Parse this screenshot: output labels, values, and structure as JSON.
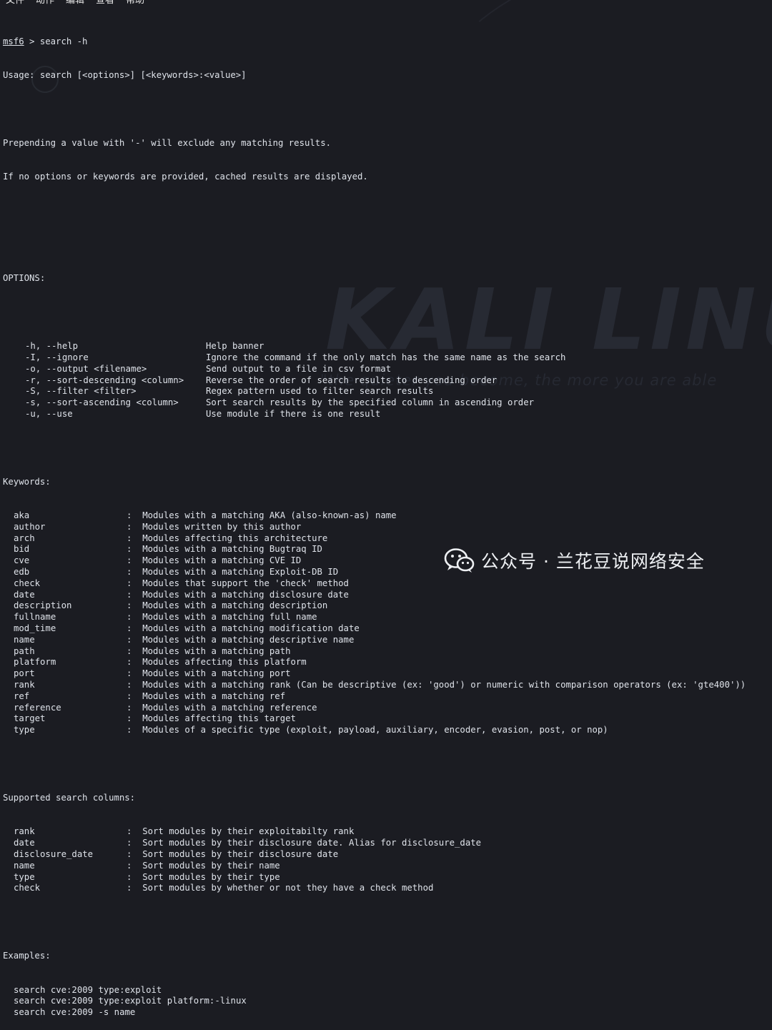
{
  "menu": [
    "文件",
    "动作",
    "编辑",
    "查看",
    "帮助"
  ],
  "wallpaper": {
    "logo": "KALI LINU",
    "tagline": "\"the quieter you become, the more you are able"
  },
  "terminal": {
    "prompt_host": "msf6",
    "prompt_rest": " > search -h",
    "usage": "Usage: search [<options>] [<keywords>:<value>]",
    "intro_1": "Prepending a value with '-' will exclude any matching results.",
    "intro_2": "If no options or keywords are provided, cached results are displayed.",
    "options_header": "OPTIONS:",
    "options": [
      {
        "flag": "-h, --help",
        "desc": "Help banner"
      },
      {
        "flag": "-I, --ignore",
        "desc": "Ignore the command if the only match has the same name as the search"
      },
      {
        "flag": "-o, --output <filename>",
        "desc": "Send output to a file in csv format"
      },
      {
        "flag": "-r, --sort-descending <column>",
        "desc": "Reverse the order of search results to descending order"
      },
      {
        "flag": "-S, --filter <filter>",
        "desc": "Regex pattern used to filter search results"
      },
      {
        "flag": "-s, --sort-ascending <column>",
        "desc": "Sort search results by the specified column in ascending order"
      },
      {
        "flag": "-u, --use",
        "desc": "Use module if there is one result"
      }
    ],
    "keywords_header": "Keywords:",
    "keywords": [
      {
        "key": "aka",
        "desc": ":  Modules with a matching AKA (also-known-as) name"
      },
      {
        "key": "author",
        "desc": ":  Modules written by this author"
      },
      {
        "key": "arch",
        "desc": ":  Modules affecting this architecture"
      },
      {
        "key": "bid",
        "desc": ":  Modules with a matching Bugtraq ID"
      },
      {
        "key": "cve",
        "desc": ":  Modules with a matching CVE ID"
      },
      {
        "key": "edb",
        "desc": ":  Modules with a matching Exploit-DB ID"
      },
      {
        "key": "check",
        "desc": ":  Modules that support the 'check' method"
      },
      {
        "key": "date",
        "desc": ":  Modules with a matching disclosure date"
      },
      {
        "key": "description",
        "desc": ":  Modules with a matching description"
      },
      {
        "key": "fullname",
        "desc": ":  Modules with a matching full name"
      },
      {
        "key": "mod_time",
        "desc": ":  Modules with a matching modification date"
      },
      {
        "key": "name",
        "desc": ":  Modules with a matching descriptive name"
      },
      {
        "key": "path",
        "desc": ":  Modules with a matching path"
      },
      {
        "key": "platform",
        "desc": ":  Modules affecting this platform"
      },
      {
        "key": "port",
        "desc": ":  Modules with a matching port"
      },
      {
        "key": "rank",
        "desc": ":  Modules with a matching rank (Can be descriptive (ex: 'good') or numeric with comparison operators (ex: 'gte400'))"
      },
      {
        "key": "ref",
        "desc": ":  Modules with a matching ref"
      },
      {
        "key": "reference",
        "desc": ":  Modules with a matching reference"
      },
      {
        "key": "target",
        "desc": ":  Modules affecting this target"
      },
      {
        "key": "type",
        "desc": ":  Modules of a specific type (exploit, payload, auxiliary, encoder, evasion, post, or nop)"
      }
    ],
    "columns_header": "Supported search columns:",
    "columns": [
      {
        "key": "rank",
        "desc": ":  Sort modules by their exploitabilty rank"
      },
      {
        "key": "date",
        "desc": ":  Sort modules by their disclosure date. Alias for disclosure_date"
      },
      {
        "key": "disclosure_date",
        "desc": ":  Sort modules by their disclosure date"
      },
      {
        "key": "name",
        "desc": ":  Sort modules by their name"
      },
      {
        "key": "type",
        "desc": ":  Sort modules by their type"
      },
      {
        "key": "check",
        "desc": ":  Sort modules by whether or not they have a check method"
      }
    ],
    "examples_header": "Examples:",
    "examples": [
      "search cve:2009 type:exploit",
      "search cve:2009 type:exploit platform:-linux",
      "search cve:2009 -s name"
    ]
  },
  "watermark": {
    "icon": "wechat-icon",
    "text": "公众号 · 兰花豆说网络安全"
  }
}
